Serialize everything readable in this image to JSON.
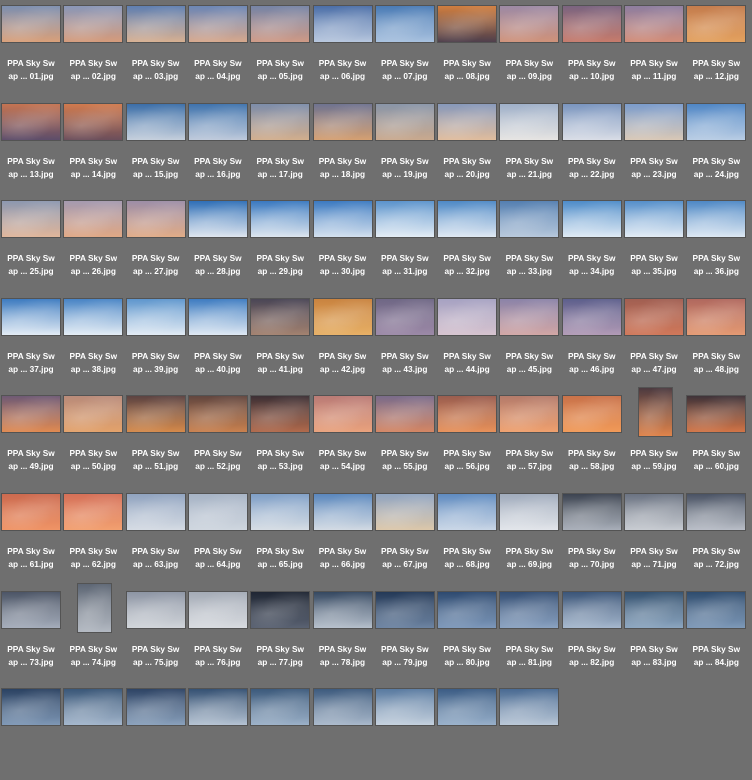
{
  "grid": {
    "columns": 12,
    "items": [
      {
        "line1": "PPA Sky Sw",
        "line2": "ap ... 01.jpg",
        "top": "#7d8fb0",
        "bottom": "#d9a07a"
      },
      {
        "line1": "PPA Sky Sw",
        "line2": "ap ... 02.jpg",
        "top": "#8a97b8",
        "bottom": "#d59b7b"
      },
      {
        "line1": "PPA Sky Sw",
        "line2": "ap ... 03.jpg",
        "top": "#5f7fb1",
        "bottom": "#d7b092"
      },
      {
        "line1": "PPA Sky Sw",
        "line2": "ap ... 04.jpg",
        "top": "#6c86b5",
        "bottom": "#d7a88d"
      },
      {
        "line1": "PPA Sky Sw",
        "line2": "ap ... 05.jpg",
        "top": "#7684a6",
        "bottom": "#cf9a86"
      },
      {
        "line1": "PPA Sky Sw",
        "line2": "ap ... 06.jpg",
        "top": "#4c6fa8",
        "bottom": "#b8c7de"
      },
      {
        "line1": "PPA Sky Sw",
        "line2": "ap ... 07.jpg",
        "top": "#4a7bb5",
        "bottom": "#a9c2df"
      },
      {
        "line1": "PPA Sky Sw",
        "line2": "ap ... 08.jpg",
        "top": "#d07e3f",
        "bottom": "#4e3f4c"
      },
      {
        "line1": "PPA Sky Sw",
        "line2": "ap ... 09.jpg",
        "top": "#9d8aa5",
        "bottom": "#cf927a"
      },
      {
        "line1": "PPA Sky Sw",
        "line2": "ap ... 10.jpg",
        "top": "#7b6480",
        "bottom": "#c67b6c"
      },
      {
        "line1": "PPA Sky Sw",
        "line2": "ap ... 11.jpg",
        "top": "#8e7ea0",
        "bottom": "#d28c77"
      },
      {
        "line1": "PPA Sky Sw",
        "line2": "ap ... 12.jpg",
        "top": "#c47c4d",
        "bottom": "#e3a15f"
      },
      {
        "line1": "PPA Sky Sw",
        "line2": "ap ... 13.jpg",
        "top": "#c47452",
        "bottom": "#5d4d6a"
      },
      {
        "line1": "PPA Sky Sw",
        "line2": "ap ... 14.jpg",
        "top": "#d07a4e",
        "bottom": "#6b4e5b"
      },
      {
        "line1": "PPA Sky Sw",
        "line2": "ap ... 15.jpg",
        "top": "#3b6ea8",
        "bottom": "#c5cfdc"
      },
      {
        "line1": "PPA Sky Sw",
        "line2": "ap ... 16.jpg",
        "top": "#3f73ad",
        "bottom": "#bfcadb"
      },
      {
        "line1": "PPA Sky Sw",
        "line2": "ap ... 17.jpg",
        "top": "#7d8daa",
        "bottom": "#d2ae8d"
      },
      {
        "line1": "PPA Sky Sw",
        "line2": "ap ... 18.jpg",
        "top": "#6f7390",
        "bottom": "#d5a072"
      },
      {
        "line1": "PPA Sky Sw",
        "line2": "ap ... 19.jpg",
        "top": "#8995a8",
        "bottom": "#c9a98e"
      },
      {
        "line1": "PPA Sky Sw",
        "line2": "ap ... 20.jpg",
        "top": "#8798ba",
        "bottom": "#e0bc9d"
      },
      {
        "line1": "PPA Sky Sw",
        "line2": "ap ... 21.jpg",
        "top": "#9fb0c9",
        "bottom": "#e6e4e2"
      },
      {
        "line1": "PPA Sky Sw",
        "line2": "ap ... 22.jpg",
        "top": "#7a95bf",
        "bottom": "#d9dde6"
      },
      {
        "line1": "PPA Sky Sw",
        "line2": "ap ... 23.jpg",
        "top": "#7b9ccc",
        "bottom": "#d9c8b6"
      },
      {
        "line1": "PPA Sky Sw",
        "line2": "ap ... 24.jpg",
        "top": "#4f86c5",
        "bottom": "#b9cde4"
      },
      {
        "line1": "PPA Sky Sw",
        "line2": "ap ... 25.jpg",
        "top": "#8d98b0",
        "bottom": "#e0b69b"
      },
      {
        "line1": "PPA Sky Sw",
        "line2": "ap ... 26.jpg",
        "top": "#a59ab0",
        "bottom": "#e0a885"
      },
      {
        "line1": "PPA Sky Sw",
        "line2": "ap ... 27.jpg",
        "top": "#9d8ea7",
        "bottom": "#e1ac88"
      },
      {
        "line1": "PPA Sky Sw",
        "line2": "ap ... 28.jpg",
        "top": "#2f6fb7",
        "bottom": "#dfe6ef"
      },
      {
        "line1": "PPA Sky Sw",
        "line2": "ap ... 29.jpg",
        "top": "#3a79c0",
        "bottom": "#dde6ef"
      },
      {
        "line1": "PPA Sky Sw",
        "line2": "ap ... 30.jpg",
        "top": "#3c7ac1",
        "bottom": "#d3e0ee"
      },
      {
        "line1": "PPA Sky Sw",
        "line2": "ap ... 31.jpg",
        "top": "#5b93cc",
        "bottom": "#e4edf5"
      },
      {
        "line1": "PPA Sky Sw",
        "line2": "ap ... 32.jpg",
        "top": "#4e89c6",
        "bottom": "#e0e9f3"
      },
      {
        "line1": "PPA Sky Sw",
        "line2": "ap ... 33.jpg",
        "top": "#547fb1",
        "bottom": "#b7c8dc"
      },
      {
        "line1": "PPA Sky Sw",
        "line2": "ap ... 34.jpg",
        "top": "#4e8cc9",
        "bottom": "#e0ebf5"
      },
      {
        "line1": "PPA Sky Sw",
        "line2": "ap ... 35.jpg",
        "top": "#558fca",
        "bottom": "#e3ecf5"
      },
      {
        "line1": "PPA Sky Sw",
        "line2": "ap ... 36.jpg",
        "top": "#4e88c5",
        "bottom": "#dde8f3"
      },
      {
        "line1": "PPA Sky Sw",
        "line2": "ap ... 37.jpg",
        "top": "#3d7bc0",
        "bottom": "#e3ecf5"
      },
      {
        "line1": "PPA Sky Sw",
        "line2": "ap ... 38.jpg",
        "top": "#4884c5",
        "bottom": "#e4edf5"
      },
      {
        "line1": "PPA Sky Sw",
        "line2": "ap ... 39.jpg",
        "top": "#5e96cd",
        "bottom": "#e2ebf4"
      },
      {
        "line1": "PPA Sky Sw",
        "line2": "ap ... 40.jpg",
        "top": "#3e7cc1",
        "bottom": "#dfe9f3"
      },
      {
        "line1": "PPA Sky Sw",
        "line2": "ap ... 41.jpg",
        "top": "#4a4656",
        "bottom": "#a38270"
      },
      {
        "line1": "PPA Sky Sw",
        "line2": "ap ... 42.jpg",
        "top": "#c9833f",
        "bottom": "#e7b066"
      },
      {
        "line1": "PPA Sky Sw",
        "line2": "ap ... 43.jpg",
        "top": "#6f6785",
        "bottom": "#9c89a7"
      },
      {
        "line1": "PPA Sky Sw",
        "line2": "ap ... 44.jpg",
        "top": "#a6a2c2",
        "bottom": "#d6c3cf"
      },
      {
        "line1": "PPA Sky Sw",
        "line2": "ap ... 45.jpg",
        "top": "#8b83a8",
        "bottom": "#d2a6a5"
      },
      {
        "line1": "PPA Sky Sw",
        "line2": "ap ... 46.jpg",
        "top": "#5d5f8c",
        "bottom": "#b29bb6"
      },
      {
        "line1": "PPA Sky Sw",
        "line2": "ap ... 47.jpg",
        "top": "#a15f52",
        "bottom": "#d0785a"
      },
      {
        "line1": "PPA Sky Sw",
        "line2": "ap ... 48.jpg",
        "top": "#b0685e",
        "bottom": "#e49a73"
      },
      {
        "line1": "PPA Sky Sw",
        "line2": "ap ... 49.jpg",
        "top": "#6f5a75",
        "bottom": "#e08a52"
      },
      {
        "line1": "PPA Sky Sw",
        "line2": "ap ... 50.jpg",
        "top": "#b98b7a",
        "bottom": "#e3a26b"
      },
      {
        "line1": "PPA Sky Sw",
        "line2": "ap ... 51.jpg",
        "top": "#5c4342",
        "bottom": "#d58a4b"
      },
      {
        "line1": "PPA Sky Sw",
        "line2": "ap ... 52.jpg",
        "top": "#62463f",
        "bottom": "#c9814f"
      },
      {
        "line1": "PPA Sky Sw",
        "line2": "ap ... 53.jpg",
        "top": "#3d3035",
        "bottom": "#b16a4c"
      },
      {
        "line1": "PPA Sky Sw",
        "line2": "ap ... 54.jpg",
        "top": "#ba7b76",
        "bottom": "#e9a27d"
      },
      {
        "line1": "PPA Sky Sw",
        "line2": "ap ... 55.jpg",
        "top": "#7a6c8b",
        "bottom": "#d48664"
      },
      {
        "line1": "PPA Sky Sw",
        "line2": "ap ... 56.jpg",
        "top": "#9a5d4f",
        "bottom": "#e7915a"
      },
      {
        "line1": "PPA Sky Sw",
        "line2": "ap ... 57.jpg",
        "top": "#b47b6b",
        "bottom": "#efa06e"
      },
      {
        "line1": "PPA Sky Sw",
        "line2": "ap ... 58.jpg",
        "top": "#c9724a",
        "bottom": "#f19a58"
      },
      {
        "line1": "PPA Sky Sw",
        "line2": "ap ... 59.jpg",
        "top": "#4c3a40",
        "bottom": "#e0844b"
      },
      {
        "line1": "PPA Sky Sw",
        "line2": "ap ... 60.jpg",
        "top": "#3f3339",
        "bottom": "#d27547"
      },
      {
        "line1": "PPA Sky Sw",
        "line2": "ap ... 61.jpg",
        "top": "#cc6a4f",
        "bottom": "#ef9466"
      },
      {
        "line1": "PPA Sky Sw",
        "line2": "ap ... 62.jpg",
        "top": "#d57058",
        "bottom": "#f2a070"
      },
      {
        "line1": "PPA Sky Sw",
        "line2": "ap ... 63.jpg",
        "top": "#90a3bf",
        "bottom": "#d5dbe3"
      },
      {
        "line1": "PPA Sky Sw",
        "line2": "ap ... 64.jpg",
        "top": "#a6b3c5",
        "bottom": "#cfd6df"
      },
      {
        "line1": "PPA Sky Sw",
        "line2": "ap ... 65.jpg",
        "top": "#7f9fc7",
        "bottom": "#d6dde4"
      },
      {
        "line1": "PPA Sky Sw",
        "line2": "ap ... 66.jpg",
        "top": "#5a87bd",
        "bottom": "#d2dae3"
      },
      {
        "line1": "PPA Sky Sw",
        "line2": "ap ... 67.jpg",
        "top": "#90a4c0",
        "bottom": "#dcc7aa"
      },
      {
        "line1": "PPA Sky Sw",
        "line2": "ap ... 68.jpg",
        "top": "#5f8bc0",
        "bottom": "#c9d6e6"
      },
      {
        "line1": "PPA Sky Sw",
        "line2": "ap ... 69.jpg",
        "top": "#a0abbc",
        "bottom": "#e2e5ea"
      },
      {
        "line1": "PPA Sky Sw",
        "line2": "ap ... 70.jpg",
        "top": "#3d4451",
        "bottom": "#a9afb9"
      },
      {
        "line1": "PPA Sky Sw",
        "line2": "ap ... 71.jpg",
        "top": "#6b7382",
        "bottom": "#c7cbd1"
      },
      {
        "line1": "PPA Sky Sw",
        "line2": "ap ... 72.jpg",
        "top": "#4a5364",
        "bottom": "#b9bec7"
      },
      {
        "line1": "PPA Sky Sw",
        "line2": "ap ... 73.jpg",
        "top": "#4c5566",
        "bottom": "#a5adbb"
      },
      {
        "line1": "PPA Sky Sw",
        "line2": "ap ... 74.jpg",
        "top": "#5d6674",
        "bottom": "#b3b9c2"
      },
      {
        "line1": "PPA Sky Sw",
        "line2": "ap ... 75.jpg",
        "top": "#8d95a4",
        "bottom": "#d1d5da"
      },
      {
        "line1": "PPA Sky Sw",
        "line2": "ap ... 76.jpg",
        "top": "#a4abb6",
        "bottom": "#d8dbe0"
      },
      {
        "line1": "PPA Sky Sw",
        "line2": "ap ... 77.jpg",
        "top": "#1f2633",
        "bottom": "#5a6272"
      },
      {
        "line1": "PPA Sky Sw",
        "line2": "ap ... 78.jpg",
        "top": "#354861",
        "bottom": "#b6c0cc"
      },
      {
        "line1": "PPA Sky Sw",
        "line2": "ap ... 79.jpg",
        "top": "#243957",
        "bottom": "#6d84a2"
      },
      {
        "line1": "PPA Sky Sw",
        "line2": "ap ... 80.jpg",
        "top": "#2e4a70",
        "bottom": "#7d98ba"
      },
      {
        "line1": "PPA Sky Sw",
        "line2": "ap ... 81.jpg",
        "top": "#344e73",
        "bottom": "#8ba3c2"
      },
      {
        "line1": "PPA Sky Sw",
        "line2": "ap ... 82.jpg",
        "top": "#3b5578",
        "bottom": "#a6b8ce"
      },
      {
        "line1": "PPA Sky Sw",
        "line2": "ap ... 83.jpg",
        "top": "#34516f",
        "bottom": "#8ca6c0"
      },
      {
        "line1": "PPA Sky Sw",
        "line2": "ap ... 84.jpg",
        "top": "#2f4c6e",
        "bottom": "#7e99b8"
      },
      {
        "top": "#2b4262",
        "bottom": "#7f98b6"
      },
      {
        "top": "#3a5778",
        "bottom": "#a3b6cc"
      },
      {
        "top": "#2e4465",
        "bottom": "#8aa1bc"
      },
      {
        "top": "#355173",
        "bottom": "#b5c3d3"
      },
      {
        "top": "#3c5a7c",
        "bottom": "#9cb1c8"
      },
      {
        "top": "#3e5b7e",
        "bottom": "#aab9cb"
      },
      {
        "top": "#597aa0",
        "bottom": "#c5d1de"
      },
      {
        "top": "#3c5d85",
        "bottom": "#98b0ca"
      },
      {
        "top": "#496a92",
        "bottom": "#b9c7d7"
      }
    ]
  }
}
